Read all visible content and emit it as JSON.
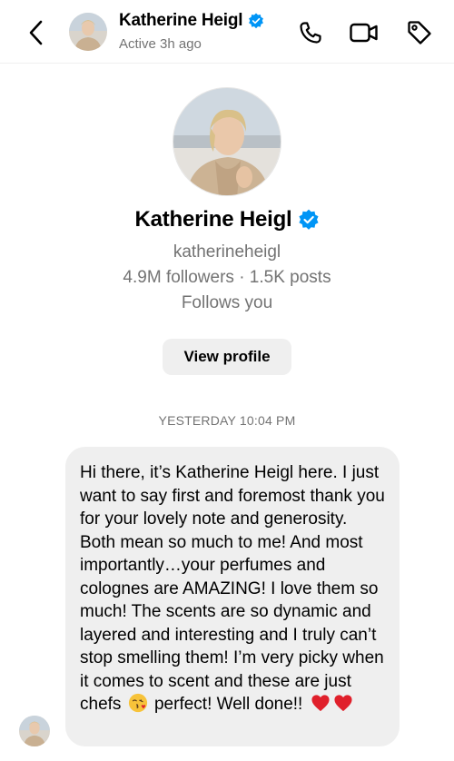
{
  "header": {
    "back_icon": "chevron-left-icon",
    "name": "Katherine Heigl",
    "status": "Active 3h ago",
    "verified_icon": "verified-badge-icon",
    "actions": [
      {
        "icon": "phone-icon"
      },
      {
        "icon": "video-camera-icon"
      },
      {
        "icon": "tag-icon"
      }
    ]
  },
  "profile": {
    "name": "Katherine Heigl",
    "handle": "katherineheigl",
    "stats": "4.9M followers · 1.5K posts",
    "follows_text": "Follows you",
    "view_profile_label": "View profile"
  },
  "thread": {
    "timestamp": "YESTERDAY 10:04 PM",
    "message": {
      "text_before_emoji": "Hi there, it’s Katherine Heigl here. I just want to say first and foremost thank you for your lovely note and generosity. Both mean so much to me! And most importantly…your perfumes and colognes are AMAZING! I love them so much! The scents are so dynamic and layered and interesting and I truly can’t stop smelling them! I’m very picky when it comes to scent and these are just chefs",
      "emoji": "face-blowing-kiss-icon",
      "text_after_emoji": "perfect! Well done!!",
      "trailing_emojis": [
        "red-heart-icon",
        "red-heart-icon"
      ]
    }
  },
  "colors": {
    "verified_blue": "#0095f6",
    "bubble_bg": "#efefef",
    "secondary_text": "#737373",
    "heart_red": "#e0202b"
  }
}
